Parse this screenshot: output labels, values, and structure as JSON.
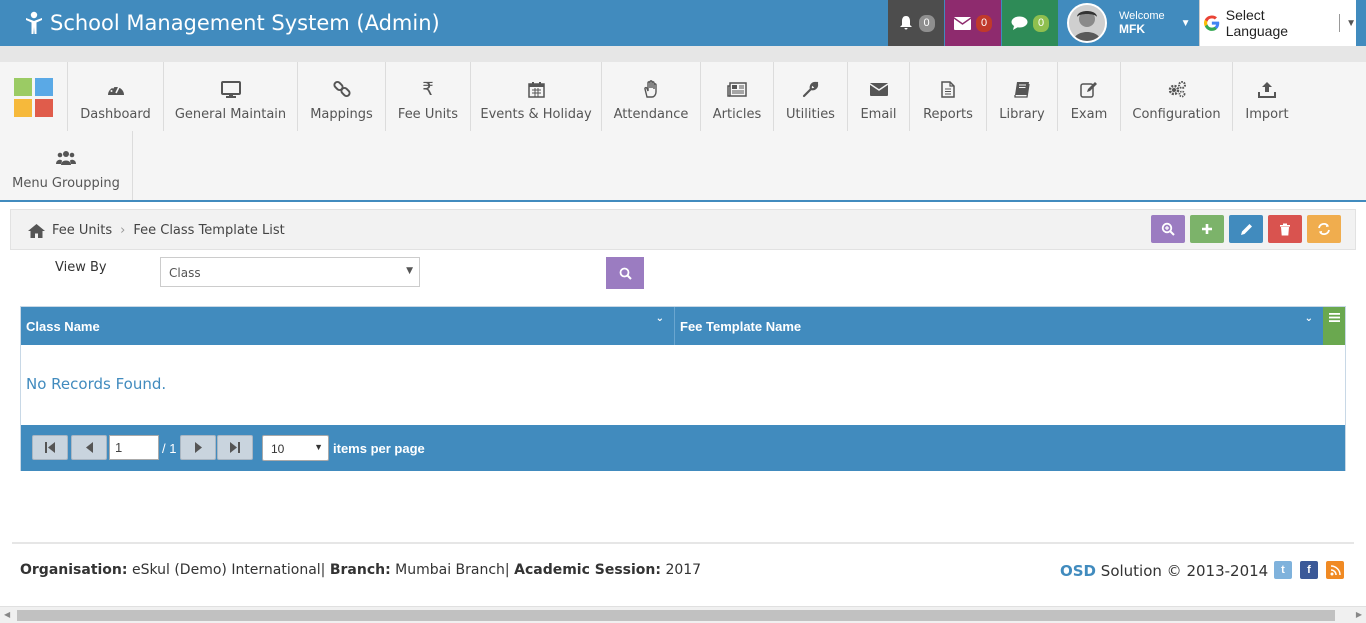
{
  "header": {
    "title": "School Management System (Admin)",
    "notifications": {
      "icon": "bell-icon",
      "count": "0",
      "bg": "#4d4d4d"
    },
    "messages": {
      "icon": "envelope-icon",
      "count": "0",
      "bg": "#8e2b6e"
    },
    "chats": {
      "icon": "comment-icon",
      "count": "0",
      "bg": "#2e8b57"
    },
    "user": {
      "welcome": "Welcome",
      "name": "MFK"
    },
    "language": "Select Language",
    "accent": "#418bbe"
  },
  "menu": {
    "items": [
      {
        "label": "Dashboard",
        "icon": "dashboard-icon"
      },
      {
        "label": "General Maintain",
        "icon": "monitor-icon"
      },
      {
        "label": "Mappings",
        "icon": "link-icon"
      },
      {
        "label": "Fee Units",
        "icon": "rupee-icon"
      },
      {
        "label": "Events & Holiday",
        "icon": "calendar-icon"
      },
      {
        "label": "Attendance",
        "icon": "hand-icon"
      },
      {
        "label": "Articles",
        "icon": "newspaper-icon"
      },
      {
        "label": "Utilities",
        "icon": "wrench-icon"
      },
      {
        "label": "Email",
        "icon": "envelope-icon"
      },
      {
        "label": "Reports",
        "icon": "file-icon"
      },
      {
        "label": "Library",
        "icon": "book-icon"
      },
      {
        "label": "Exam",
        "icon": "edit-icon"
      },
      {
        "label": "Configuration",
        "icon": "gears-icon"
      },
      {
        "label": "Import",
        "icon": "upload-icon"
      },
      {
        "label": "Menu Groupping",
        "icon": "users-icon"
      }
    ]
  },
  "breadcrumb": {
    "home": "Fee Units",
    "current": "Fee Class Template List"
  },
  "filter": {
    "label": "View By",
    "selected": "Class"
  },
  "grid": {
    "columns": [
      "Class Name",
      "Fee Template Name"
    ],
    "empty_message": "No Records Found.",
    "pager": {
      "page": "1",
      "of": "/ 1",
      "page_size": "10",
      "items_per_page": "items per page"
    }
  },
  "footer": {
    "org_label": "Organisation:",
    "org_value": "eSkul (Demo) International|",
    "branch_label": "Branch:",
    "branch_value": "Mumbai Branch|",
    "session_label": "Academic Session:",
    "session_value": "2017",
    "company": "OSD",
    "copyright": "Solution © 2013-2014"
  }
}
